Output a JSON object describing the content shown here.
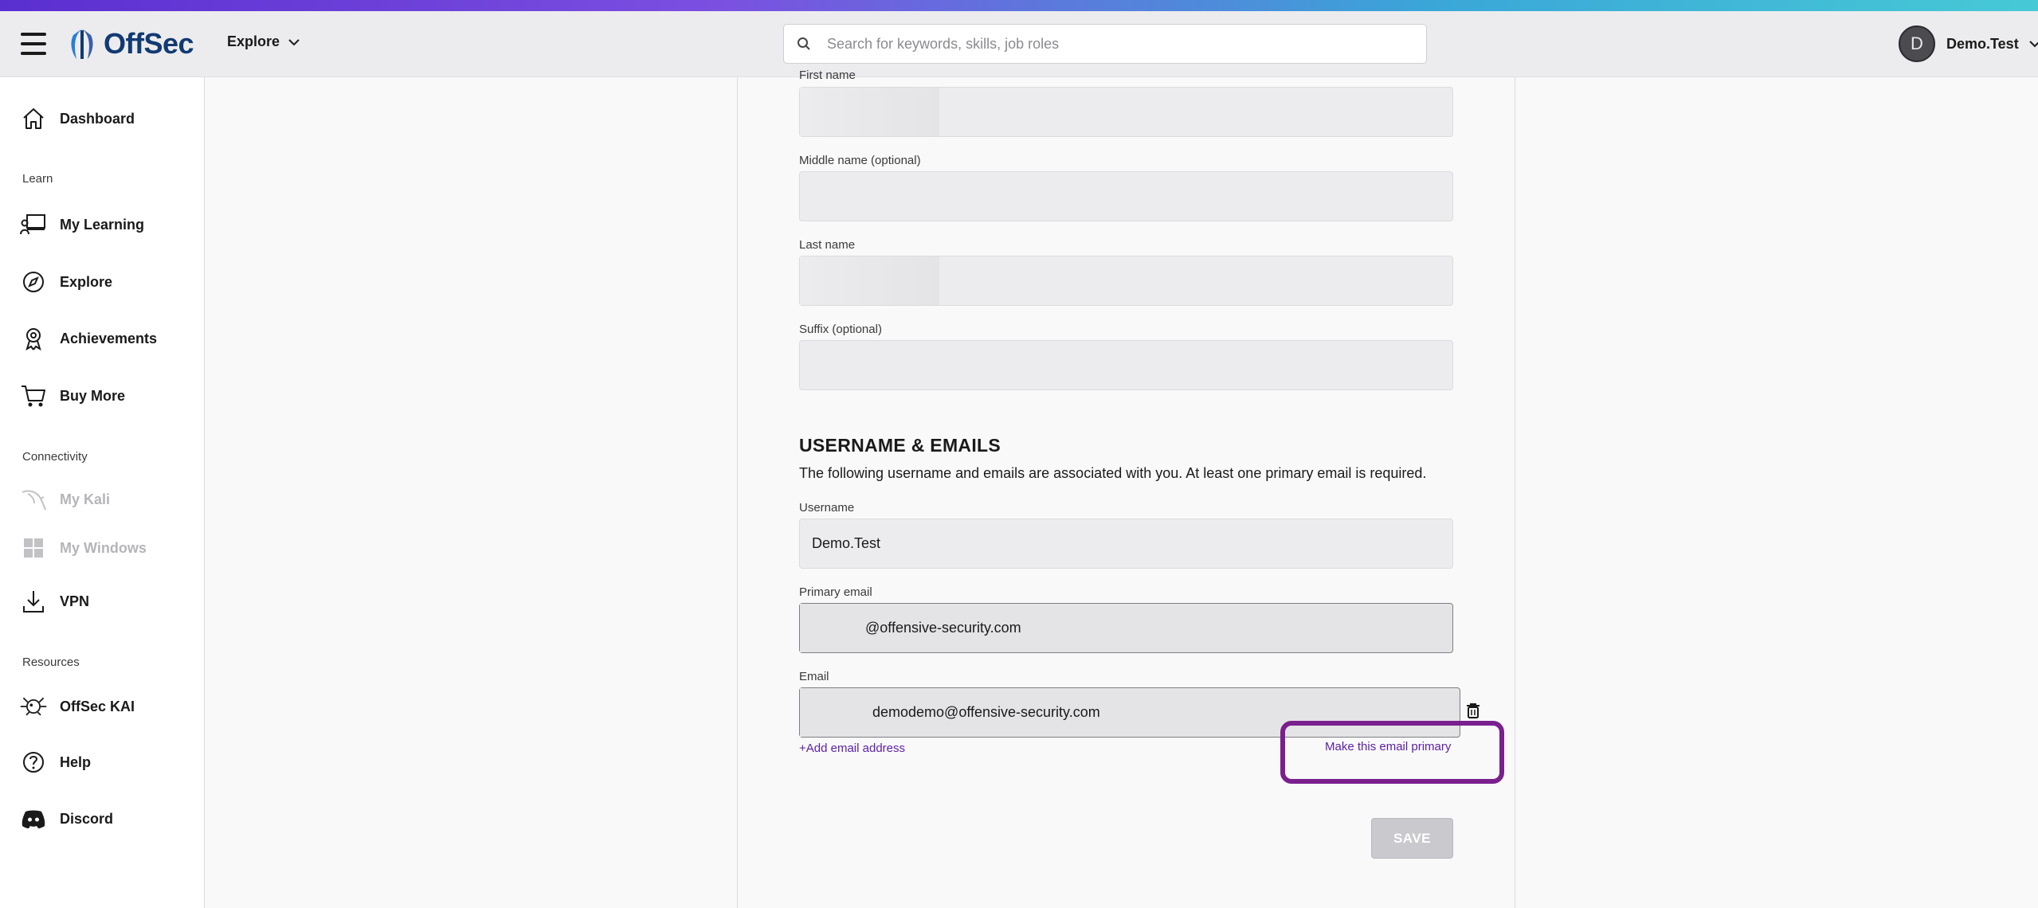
{
  "header": {
    "brand": "OffSec",
    "explore_label": "Explore",
    "search_placeholder": "Search for keywords, skills, job roles",
    "user_initial": "D",
    "user_name": "Demo.Test"
  },
  "sidebar": {
    "dashboard": "Dashboard",
    "section_learn": "Learn",
    "my_learning": "My Learning",
    "explore": "Explore",
    "achievements": "Achievements",
    "buy_more": "Buy More",
    "section_connectivity": "Connectivity",
    "my_kali": "My Kali",
    "my_windows": "My Windows",
    "vpn": "VPN",
    "section_resources": "Resources",
    "offsec_kai": "OffSec KAI",
    "help": "Help",
    "discord": "Discord"
  },
  "form": {
    "first_name_label": "First name",
    "first_name_value": "",
    "middle_name_label": "Middle name (optional)",
    "middle_name_value": "",
    "last_name_label": "Last name",
    "last_name_value": "",
    "suffix_label": "Suffix (optional)",
    "suffix_value": "",
    "section_title": "USERNAME & EMAILS",
    "section_desc": "The following username and emails are associated with you. At least one primary email is required.",
    "username_label": "Username",
    "username_value": "Demo.Test",
    "primary_email_label": "Primary email",
    "primary_email_value": "@offensive-security.com",
    "email_label": "Email",
    "email_value": "demodemo@offensive-security.com",
    "add_email_link": "+Add email address",
    "make_primary_link": "Make this email primary",
    "save_label": "SAVE"
  },
  "colors": {
    "accent_purple": "#5b1fa8",
    "highlight_border": "#7a1f8e",
    "brand_navy": "#123a73"
  }
}
